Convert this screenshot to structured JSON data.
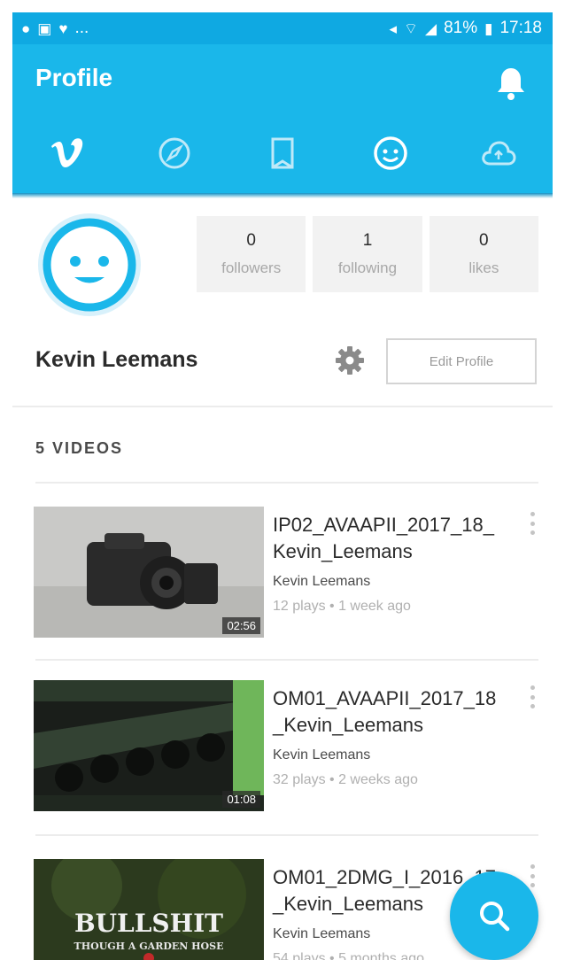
{
  "status_bar": {
    "left_icons": [
      "messenger-icon",
      "image-icon",
      "heart-icon"
    ],
    "ellipsis": "...",
    "battery": "81%",
    "time": "17:18"
  },
  "app_bar": {
    "title": "Profile",
    "nav": [
      "vimeo-logo-icon",
      "compass-icon",
      "bookmark-icon",
      "face-icon",
      "cloud-upload-icon"
    ]
  },
  "profile": {
    "name": "Kevin Leemans",
    "edit_label": "Edit Profile",
    "stats": [
      {
        "count": "0",
        "label": "followers"
      },
      {
        "count": "1",
        "label": "following"
      },
      {
        "count": "0",
        "label": "likes"
      }
    ]
  },
  "videos_header": "5 VIDEOS",
  "videos": [
    {
      "title": "IP02_AVAAPII_2017_18_Kevin_Leemans",
      "author": "Kevin Leemans",
      "meta": "12 plays • 1 week ago",
      "duration": "02:56"
    },
    {
      "title": "OM01_AVAAPII_2017_18_Kevin_Leemans",
      "author": "Kevin Leemans",
      "meta": "32 plays • 2 weeks ago",
      "duration": "01:08"
    },
    {
      "title": "OM01_2DMG_I_2016_17_Kevin_Leemans",
      "author": "Kevin Leemans",
      "meta": "54 plays • 5 months ago",
      "duration": ""
    }
  ],
  "thumb3_text": {
    "line1": "BULLSHIT",
    "line2": "THOUGH A GARDEN HOSE"
  },
  "colors": {
    "accent": "#1ab7ea",
    "status_bar": "#0fa9e2"
  }
}
